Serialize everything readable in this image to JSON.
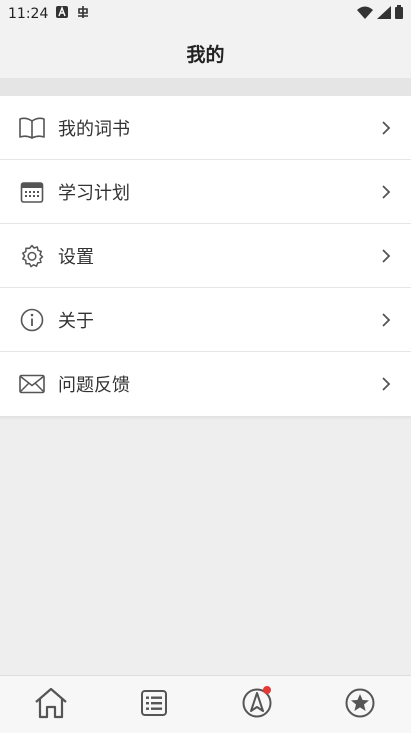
{
  "status_bar": {
    "time": "11:24",
    "notif_icons": [
      "a-icon",
      "sim-icon"
    ],
    "system_icons": [
      "wifi-icon",
      "signal-icon",
      "battery-icon"
    ]
  },
  "header": {
    "title": "我的"
  },
  "menu": {
    "items": [
      {
        "label": "我的词书",
        "icon": "book-icon"
      },
      {
        "label": "学习计划",
        "icon": "calendar-icon"
      },
      {
        "label": "设置",
        "icon": "gear-icon"
      },
      {
        "label": "关于",
        "icon": "info-icon"
      },
      {
        "label": "问题反馈",
        "icon": "mail-icon"
      }
    ]
  },
  "tabbar": {
    "tabs": [
      {
        "icon": "home-icon"
      },
      {
        "icon": "list-icon"
      },
      {
        "icon": "compass-icon",
        "badge": true
      },
      {
        "icon": "star-icon"
      }
    ]
  },
  "colors": {
    "accent_badge": "#e53935",
    "icon_gray": "#555555",
    "background": "#eeeeee"
  }
}
